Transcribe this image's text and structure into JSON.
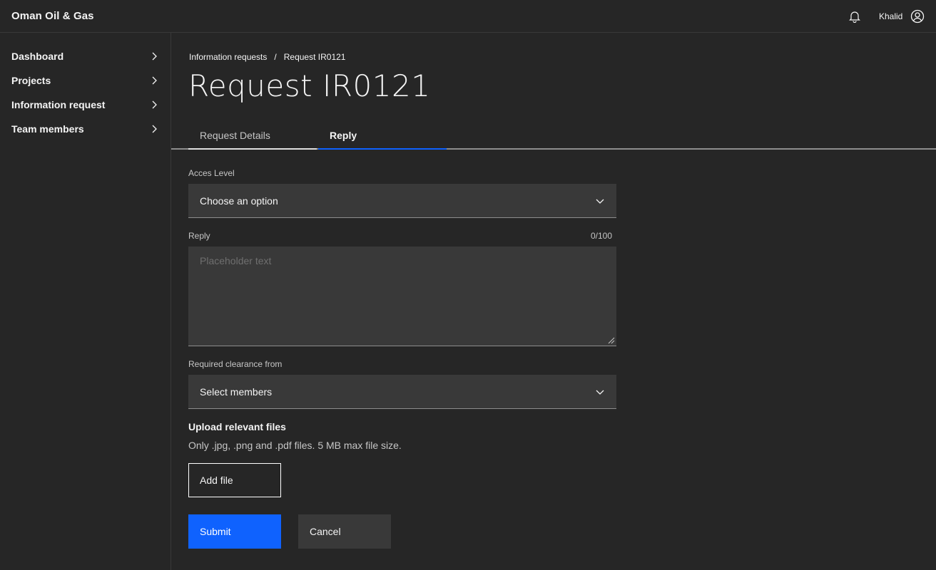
{
  "header": {
    "brand": "Oman Oil & Gas",
    "notification_icon": "bell-icon",
    "username": "Khalid",
    "avatar_icon": "user-avatar-icon"
  },
  "sidebar": {
    "items": [
      {
        "label": "Dashboard",
        "icon": "chevron-right-icon"
      },
      {
        "label": "Projects",
        "icon": "chevron-right-icon"
      },
      {
        "label": "Information request",
        "icon": "chevron-right-icon"
      },
      {
        "label": "Team members",
        "icon": "chevron-right-icon"
      }
    ]
  },
  "breadcrumb": {
    "items": [
      "Information requests",
      "Request IR0121"
    ],
    "separator": "/"
  },
  "page_title": "Request IR0121",
  "tabs": [
    {
      "label": "Request Details",
      "selected": false
    },
    {
      "label": "Reply",
      "selected": true
    }
  ],
  "form": {
    "access_level": {
      "label": "Acces Level",
      "value": "Choose an option"
    },
    "reply": {
      "label": "Reply",
      "counter": "0/100",
      "placeholder": "Placeholder text"
    },
    "clearance": {
      "label": "Required clearance from",
      "value": "Select members"
    },
    "upload": {
      "title": "Upload relevant files",
      "description": "Only .jpg, .png and .pdf files. 5 MB max file size.",
      "button_label": "Add file"
    },
    "submit_label": "Submit",
    "cancel_label": "Cancel"
  },
  "colors": {
    "background": "#262626",
    "field": "#393939",
    "primary": "#0f62fe"
  }
}
